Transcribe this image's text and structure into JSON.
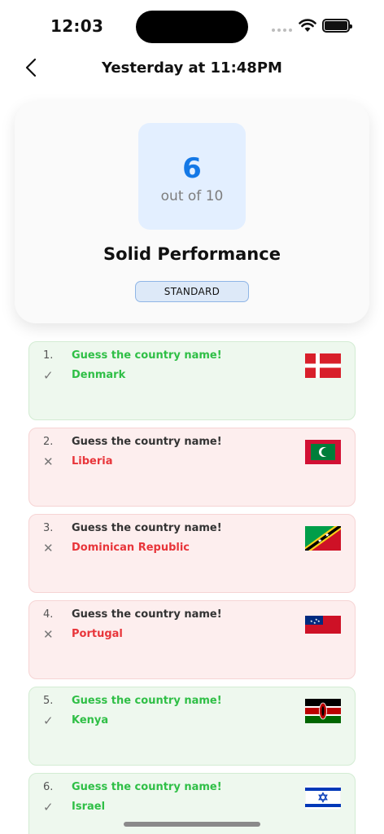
{
  "status_bar": {
    "time": "12:03"
  },
  "nav": {
    "title": "Yesterday at 11:48PM"
  },
  "score": {
    "value": "6",
    "out_of": "out of 10",
    "rating": "Solid Performance",
    "mode": "STANDARD"
  },
  "results": [
    {
      "index": "1.",
      "prompt": "Guess the country name!",
      "answer": "Denmark",
      "correct": true,
      "flag": "denmark-flag-icon"
    },
    {
      "index": "2.",
      "prompt": "Guess the country name!",
      "answer": "Liberia",
      "correct": false,
      "flag": "maldives-flag-icon"
    },
    {
      "index": "3.",
      "prompt": "Guess the country name!",
      "answer": "Dominican Republic",
      "correct": false,
      "flag": "saint-kitts-and-nevis-flag-icon"
    },
    {
      "index": "4.",
      "prompt": "Guess the country name!",
      "answer": "Portugal",
      "correct": false,
      "flag": "samoa-flag-icon"
    },
    {
      "index": "5.",
      "prompt": "Guess the country name!",
      "answer": "Kenya",
      "correct": true,
      "flag": "kenya-flag-icon"
    },
    {
      "index": "6.",
      "prompt": "Guess the country name!",
      "answer": "Israel",
      "correct": true,
      "flag": "israel-flag-icon"
    }
  ],
  "marks": {
    "correct": "✓",
    "wrong": "✕"
  },
  "colors": {
    "accent": "#1478e6",
    "correct": "#2fbf46",
    "wrong": "#e8353a"
  }
}
